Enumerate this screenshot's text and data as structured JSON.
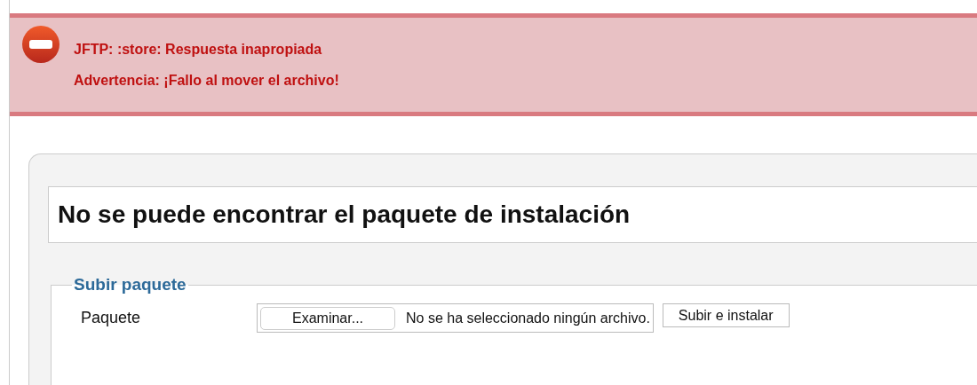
{
  "alert": {
    "kind": "error",
    "messages": [
      "JFTP: :store: Respuesta inapropiada",
      "Advertencia: ¡Fallo al mover el archivo!"
    ]
  },
  "panel": {
    "title": "No se puede encontrar el paquete de instalación",
    "fieldset": {
      "legend": "Subir paquete",
      "label": "Paquete",
      "file_button": "Examinar...",
      "file_status": "No se ha seleccionado ningún archivo.",
      "submit_button": "Subir e instalar"
    }
  }
}
